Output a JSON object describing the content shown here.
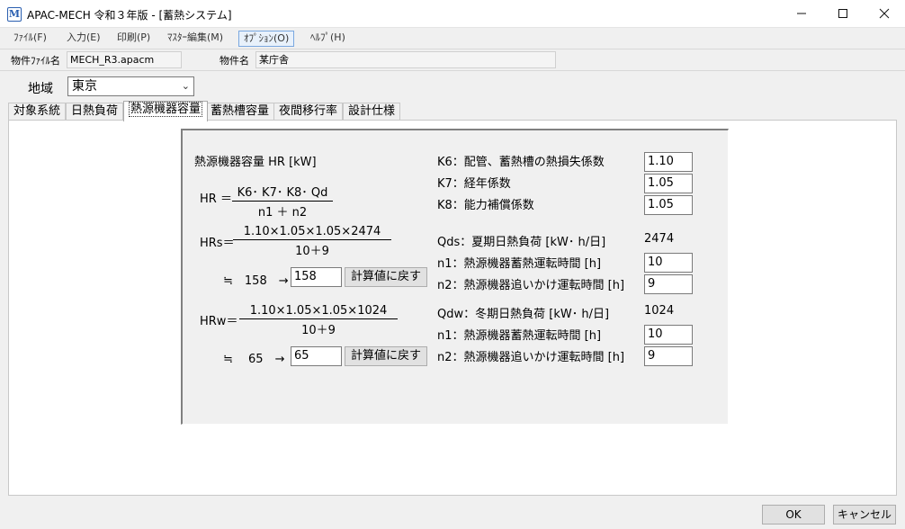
{
  "window": {
    "title": "APAC-MECH 令和３年版 - [蓄熱システム]",
    "icon": "M"
  },
  "menu": [
    "ﾌｧｲﾙ(F)",
    "入力(E)",
    "印刷(P)",
    "ﾏｽﾀｰ編集(M)",
    "ｵﾌﾟｼｮﾝ(O)",
    "ﾍﾙﾌﾟ(H)"
  ],
  "file": {
    "file_label": "物件ﾌｧｲﾙ名",
    "file_value": "MECH_R3.apacm",
    "name_label": "物件名",
    "name_value": "某庁舎"
  },
  "region": {
    "label": "地域",
    "value": "東京"
  },
  "tabs": [
    "対象系統",
    "日熱負荷",
    "熱源機器容量",
    "蓄熱槽容量",
    "夜間移行率",
    "設計仕様"
  ],
  "content": {
    "heading": "熱源機器容量 HR [kW]",
    "hr_formula": {
      "lhs": "HR ＝",
      "num": "K6･ K7･ K8･ Qd",
      "den": "n1 ＋ n2"
    },
    "hrs_formula": {
      "lhs": "HRs＝",
      "num": "1.10×1.05×1.05×2474",
      "den": "10＋9"
    },
    "hrs_approx": "≒　158　→",
    "hrs_value": "158",
    "hrs_button": "計算値に戻す",
    "hrw_formula": {
      "lhs": "HRw＝",
      "num": "1.10×1.05×1.05×1024",
      "den": "10＋9"
    },
    "hrw_approx": "≒　 65　→",
    "hrw_value": "65",
    "hrw_button": "計算値に戻す",
    "k6_label": "K6：配管、蓄熱槽の熱損失係数",
    "k6_value": "1.10",
    "k7_label": "K7：経年係数",
    "k7_value": "1.05",
    "k8_label": "K8：能力補償係数",
    "k8_value": "1.05",
    "qds_label": "Qds：夏期日熱負荷 [kW･ h/日]",
    "qds_value": "2474",
    "n1s_label": "n1：熱源機器蓄熱運転時間 [h]",
    "n1s_value": "10",
    "n2s_label": "n2：熱源機器追いかけ運転時間 [h]",
    "n2s_value": "9",
    "qdw_label": "Qdw：冬期日熱負荷 [kW･ h/日]",
    "qdw_value": "1024",
    "n1w_label": "n1：熱源機器蓄熱運転時間 [h]",
    "n1w_value": "10",
    "n2w_label": "n2：熱源機器追いかけ運転時間 [h]",
    "n2w_value": "9"
  },
  "footer": {
    "ok": "OK",
    "cancel": "キャンセル"
  }
}
